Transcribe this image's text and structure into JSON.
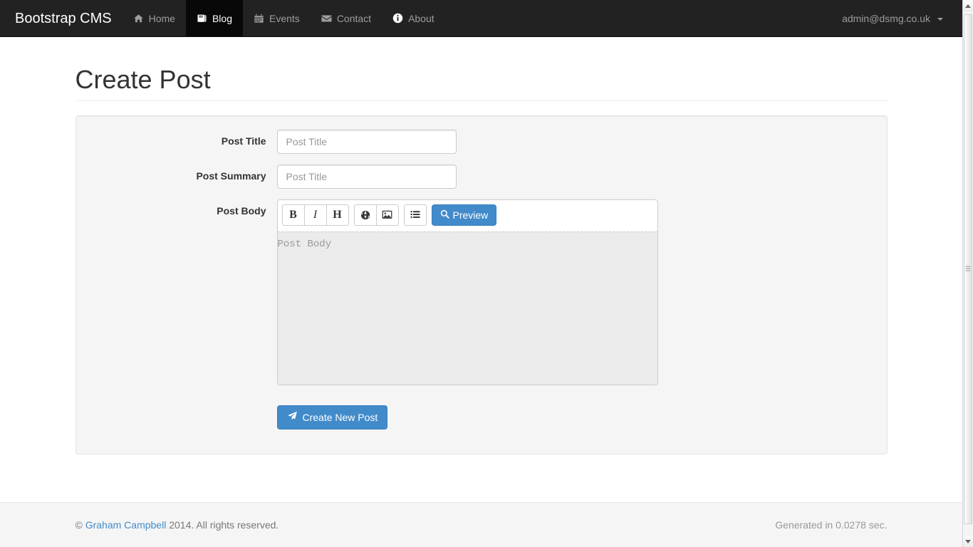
{
  "navbar": {
    "brand": "Bootstrap CMS",
    "items": [
      {
        "label": "Home",
        "icon": "home-icon",
        "active": false
      },
      {
        "label": "Blog",
        "icon": "book-icon",
        "active": true
      },
      {
        "label": "Events",
        "icon": "calendar-icon",
        "active": false
      },
      {
        "label": "Contact",
        "icon": "envelope-icon",
        "active": false
      },
      {
        "label": "About",
        "icon": "info-circle-icon",
        "active": false
      }
    ],
    "account": {
      "label": "admin@dsmg.co.uk",
      "caret_icon": "caret-down-icon"
    }
  },
  "page": {
    "title": "Create Post"
  },
  "form": {
    "fields": [
      {
        "label": "Post Title",
        "placeholder": "Post Title",
        "value": ""
      },
      {
        "label": "Post Summary",
        "placeholder": "Post Title",
        "value": ""
      }
    ],
    "body": {
      "label": "Post Body",
      "placeholder": "Post Body",
      "value": "",
      "toolbar": {
        "groups": [
          [
            {
              "name": "bold-button",
              "glyph": "B",
              "style": "gl-b"
            },
            {
              "name": "italic-button",
              "glyph": "I",
              "style": "gl-i"
            },
            {
              "name": "heading-button",
              "glyph": "H",
              "style": "gl-h"
            }
          ],
          [
            {
              "name": "link-button",
              "icon": "globe-icon"
            },
            {
              "name": "image-button",
              "icon": "picture-icon"
            }
          ],
          [
            {
              "name": "list-button",
              "icon": "list-icon"
            }
          ]
        ],
        "preview": {
          "label": "Preview",
          "icon": "search-icon"
        }
      }
    },
    "submit": {
      "label": "Create New Post",
      "icon": "paper-plane-icon"
    }
  },
  "footer": {
    "copyright_symbol": "©",
    "author": "Graham Campbell",
    "rights": "2014. All rights reserved.",
    "generated": "Generated in 0.0278 sec."
  },
  "colors": {
    "navbar_bg": "#222222",
    "navbar_active_bg": "#080808",
    "navbar_text": "#9d9d9d",
    "primary": "#428bca",
    "well_bg": "#f5f5f5",
    "textarea_bg": "#ebebeb",
    "link": "#428bca"
  }
}
